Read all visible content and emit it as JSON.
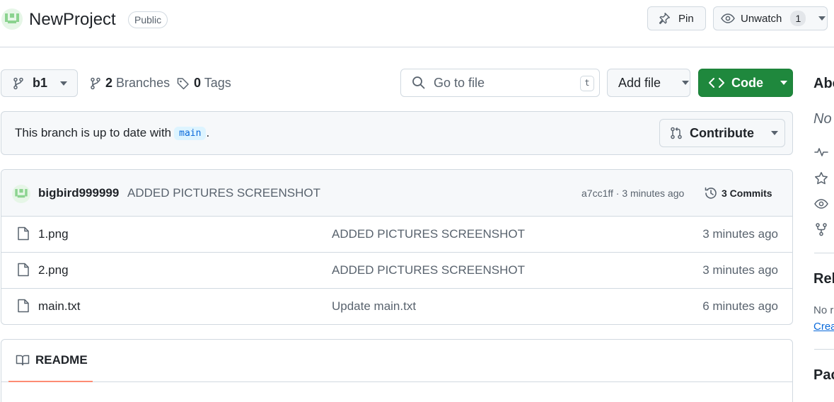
{
  "repo": {
    "name": "NewProject",
    "visibility": "Public",
    "pin_label": "Pin",
    "unwatch_label": "Unwatch",
    "watch_count": "1"
  },
  "toolbar": {
    "branch": "b1",
    "branches_count": "2",
    "branches_label": "Branches",
    "tags_count": "0",
    "tags_label": "Tags",
    "goto_placeholder": "Go to file",
    "goto_shortcut": "t",
    "add_file_label": "Add file",
    "code_label": "Code"
  },
  "banner": {
    "text": "This branch is up to date with",
    "base_branch": "main",
    "suffix": ".",
    "contribute_label": "Contribute"
  },
  "latest_commit": {
    "author": "bigbird999999",
    "message": "ADDED PICTURES SCREENSHOT",
    "meta": "a7cc1ff · 3 minutes ago",
    "commits_label": "3 Commits"
  },
  "files": [
    {
      "name": "1.png",
      "message": "ADDED PICTURES SCREENSHOT",
      "time": "3 minutes ago"
    },
    {
      "name": "2.png",
      "message": "ADDED PICTURES SCREENSHOT",
      "time": "3 minutes ago"
    },
    {
      "name": "main.txt",
      "message": "Update main.txt",
      "time": "6 minutes ago"
    }
  ],
  "readme": {
    "tab_label": "README"
  },
  "sidebar": {
    "about_heading": "Abo",
    "description": "No",
    "releases_heading": "Rel",
    "no_releases": "No r",
    "create_link": "Crea",
    "packages_heading": "Pac"
  },
  "colors": {
    "accent_green": "#1f883d",
    "link_blue": "#0969da",
    "tab_underline": "#fd8c73",
    "avatar_green": "#8bd38f"
  },
  "icons": [
    "repo-avatar-icon",
    "pin-icon",
    "eye-icon",
    "git-branch-icon",
    "tag-icon",
    "search-icon",
    "code-icon",
    "pull-request-icon",
    "history-icon",
    "file-icon",
    "book-icon",
    "pulse-icon",
    "star-icon",
    "repo-forked-icon",
    "caret-down-icon"
  ]
}
